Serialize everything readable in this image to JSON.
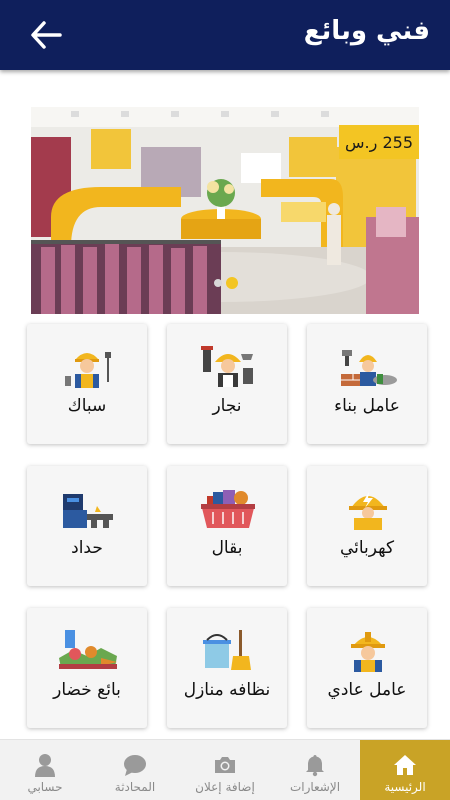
{
  "header": {
    "title": "فني وبائع",
    "back_icon": "arrow-left-icon"
  },
  "banner": {
    "price_label": "255 ر.س",
    "slide_count": 2,
    "active_slide": 2,
    "accent": "#f3c523"
  },
  "categories": [
    {
      "label": "عامل بناء",
      "icon": "construction-worker-icon"
    },
    {
      "label": "نجار",
      "icon": "carpenter-icon"
    },
    {
      "label": "سباك",
      "icon": "plumber-icon"
    },
    {
      "label": "كهربائي",
      "icon": "electrician-icon"
    },
    {
      "label": "بقال",
      "icon": "grocery-basket-icon"
    },
    {
      "label": "حداد",
      "icon": "blacksmith-welder-icon"
    },
    {
      "label": "عامل عادي",
      "icon": "general-worker-icon"
    },
    {
      "label": "نظافه منازل",
      "icon": "house-cleaning-icon"
    },
    {
      "label": "بائع خضار",
      "icon": "vegetable-seller-icon"
    }
  ],
  "bottom_nav": [
    {
      "label": "الرئيسية",
      "icon": "home-icon",
      "active": true
    },
    {
      "label": "الإشعارات",
      "icon": "bell-icon",
      "active": false
    },
    {
      "label": "إضافة إعلان",
      "icon": "camera-icon",
      "active": false
    },
    {
      "label": "المحادثة",
      "icon": "chat-bubble-icon",
      "active": false
    },
    {
      "label": "حسابي",
      "icon": "user-icon",
      "active": false
    }
  ],
  "colors": {
    "header_bg": "#0f1f5c",
    "active_tab": "#c9a326",
    "accent_yellow": "#f3c523"
  }
}
